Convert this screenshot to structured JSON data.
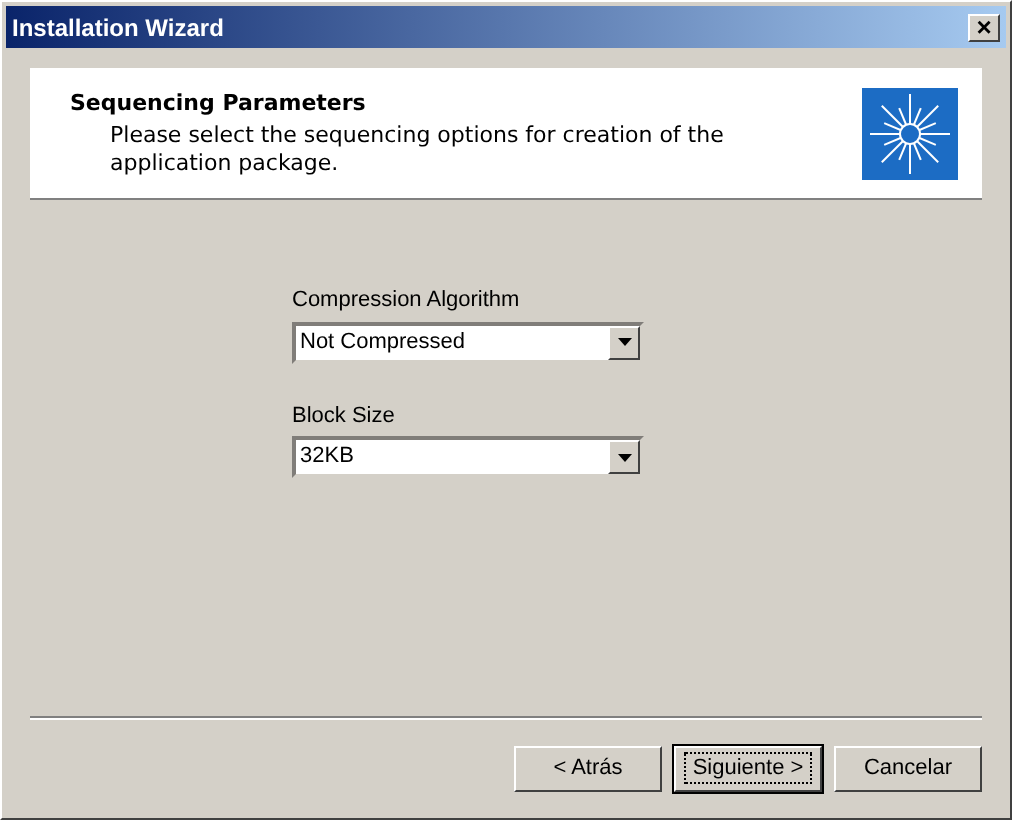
{
  "window": {
    "title": "Installation Wizard",
    "close": "×"
  },
  "header": {
    "title": "Sequencing Parameters",
    "description": "Please select the sequencing options for creation of the application package."
  },
  "fields": [
    {
      "label": "Compression Algorithm",
      "value": "Not Compressed"
    },
    {
      "label": "Block Size",
      "value": "32KB"
    }
  ],
  "buttons": [
    {
      "label": "< Atrás",
      "default": false
    },
    {
      "label": "Siguiente >",
      "default": true
    },
    {
      "label": "Cancelar",
      "default": false
    }
  ]
}
